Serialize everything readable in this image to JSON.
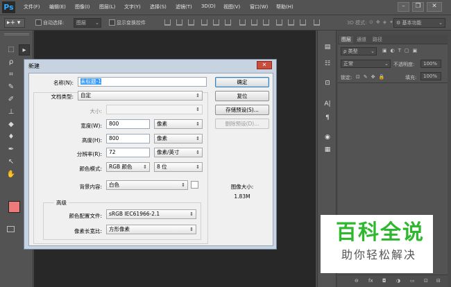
{
  "app": {
    "logo": "Ps"
  },
  "menu": [
    "文件(F)",
    "编辑(E)",
    "图像(I)",
    "图层(L)",
    "文字(Y)",
    "选择(S)",
    "滤镜(T)",
    "3D(D)",
    "视图(V)",
    "窗口(W)",
    "帮助(H)"
  ],
  "window_controls": {
    "minimize": "–",
    "restore": "❐",
    "close": "✕"
  },
  "options_bar": {
    "auto_select_label": "自动选择:",
    "auto_select_value": "图层",
    "show_transform_label": "显示变换控件",
    "mode_3d_label": "3D 模式:",
    "workspace_value": "基本功能"
  },
  "panel": {
    "tabs": [
      "图层",
      "通道",
      "路径"
    ],
    "filter_value": "ρ 类型",
    "blend_mode": "正常",
    "opacity_label": "不透明度:",
    "opacity_value": "100%",
    "lock_label": "锁定:",
    "fill_label": "填充:",
    "fill_value": "100%",
    "bottom_icons": [
      "⊖",
      "fx",
      "◘",
      "◑",
      "▭",
      "⊡",
      "⊟"
    ]
  },
  "dialog": {
    "title": "新建",
    "close_label": "✕",
    "name_label": "名称(N):",
    "name_value": "未标题-1",
    "preset_label": "文档类型:",
    "preset_value": "自定",
    "size_label": "大小:",
    "width_label": "宽度(W):",
    "width_value": "800",
    "width_unit": "像素",
    "height_label": "高度(H):",
    "height_value": "800",
    "height_unit": "像素",
    "resolution_label": "分辨率(R):",
    "resolution_value": "72",
    "resolution_unit": "像素/英寸",
    "color_mode_label": "颜色模式:",
    "color_mode_value": "RGB 颜色",
    "bit_depth_value": "8 位",
    "background_label": "背景内容:",
    "background_value": "白色",
    "advanced_label": "高级",
    "color_profile_label": "颜色配置文件:",
    "color_profile_value": "sRGB IEC61966-2.1",
    "pixel_aspect_label": "像素长宽比:",
    "pixel_aspect_value": "方形像素",
    "image_size_label": "图像大小:",
    "image_size_value": "1.83M",
    "buttons": {
      "ok": "确定",
      "reset": "复位",
      "save_preset": "存储预设(S)...",
      "delete_preset": "删除预设(D)..."
    }
  },
  "watermark": {
    "title": "百科全说",
    "subtitle": "助你轻松解决"
  },
  "colors": {
    "foreground": "#ee7a7a",
    "background": "#ffffff",
    "accent": "#3399ff"
  }
}
